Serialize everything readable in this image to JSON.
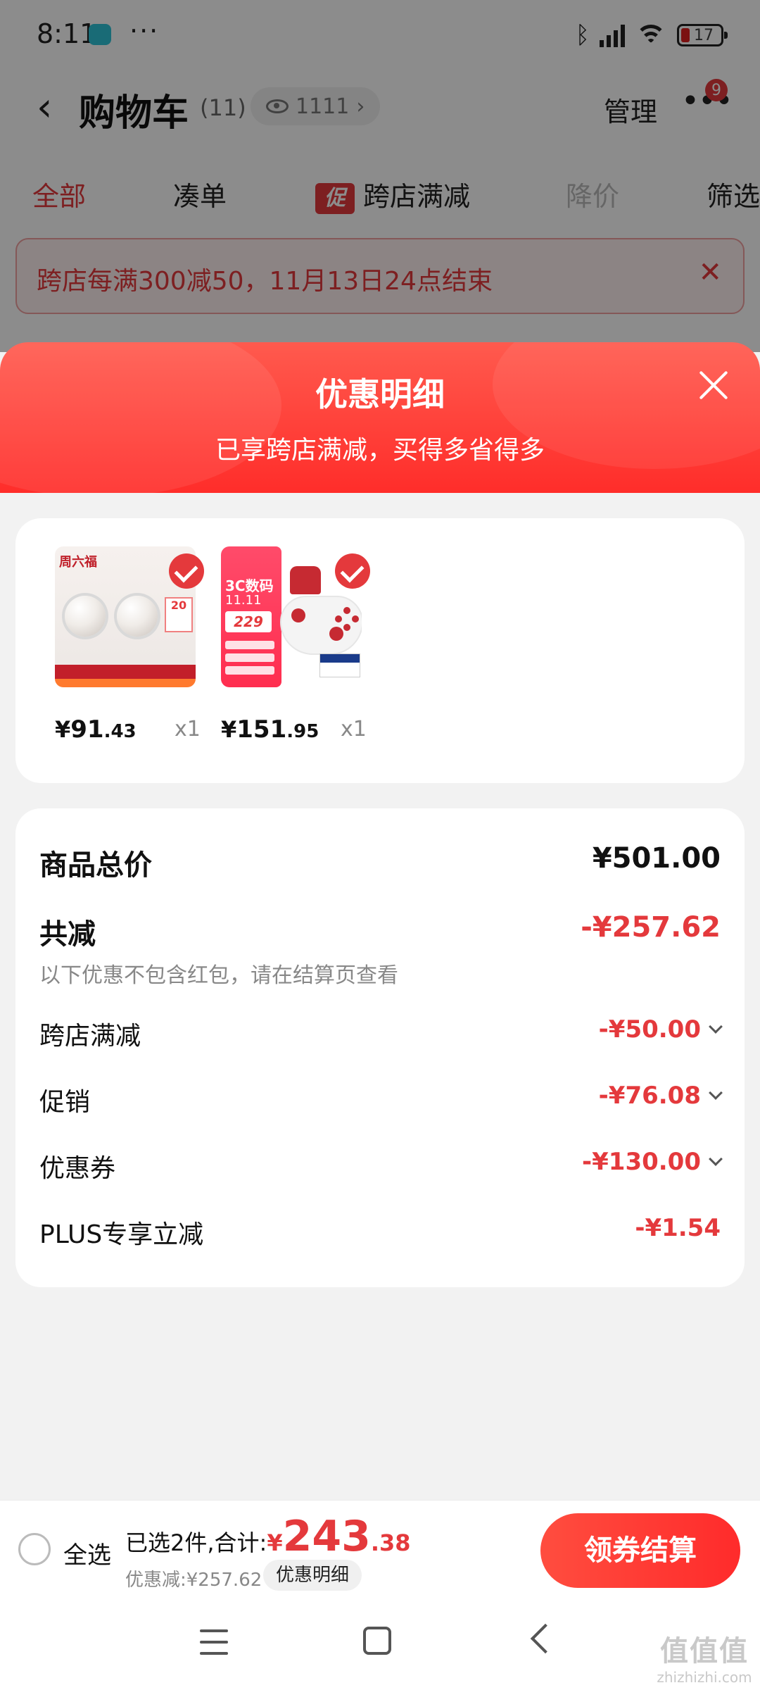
{
  "status_bar": {
    "time": "8:11",
    "more_dots": "···",
    "battery": "17"
  },
  "header": {
    "title": "购物车",
    "count": "(11)",
    "visitors": "1111",
    "manage_label": "管理",
    "more_badge": "9"
  },
  "filter_tabs": [
    {
      "label": "全部",
      "state": "active"
    },
    {
      "label": "凑单",
      "state": "normal"
    },
    {
      "label": "跨店满减",
      "state": "normal",
      "tag": "促"
    },
    {
      "label": "降价",
      "state": "muted"
    },
    {
      "label": "筛选",
      "state": "normal"
    }
  ],
  "promo_banner": {
    "text": "跨店每满300减50，11月13日24点结束"
  },
  "sheet": {
    "title": "优惠明细",
    "subtitle": "已享跨店满减，买得多省得多"
  },
  "products": [
    {
      "image": "pearl-earrings",
      "brand_text": "周六福",
      "tag_text": "20",
      "price_yen": "¥",
      "price_int": "91",
      "price_dec": ".43",
      "qty": "x1"
    },
    {
      "image": "game-controller",
      "promo_title": "3C数码",
      "promo_date": "11.11",
      "promo_price": "229",
      "price_yen": "¥",
      "price_int": "151",
      "price_dec": ".95",
      "qty": "x1"
    }
  ],
  "summary": {
    "total_label": "商品总价",
    "total_value": "¥501.00",
    "discount_label": "共减",
    "discount_value": "-¥257.62",
    "note": "以下优惠不包含红包，请在结算页查看",
    "items": [
      {
        "label": "跨店满减",
        "value": "-¥50.00",
        "expandable": true
      },
      {
        "label": "促销",
        "value": "-¥76.08",
        "expandable": true
      },
      {
        "label": "优惠券",
        "value": "-¥130.00",
        "expandable": true
      },
      {
        "label": "PLUS专享立减",
        "value": "-¥1.54",
        "expandable": false
      }
    ]
  },
  "checkout": {
    "select_all": "全选",
    "total_prefix": "已选2件,合计:",
    "total_yen": "¥",
    "total_int": "243",
    "total_dec": ".38",
    "discount_text": "优惠减:¥257.62",
    "detail_label": "优惠明细",
    "button_label": "领券结算"
  },
  "watermark": {
    "logo": "值值值",
    "text": "zhizhizhi.com"
  },
  "colors": {
    "accent": "#e4393c",
    "sheet_header": "#ff3b30",
    "background": "#f2f2f2"
  }
}
